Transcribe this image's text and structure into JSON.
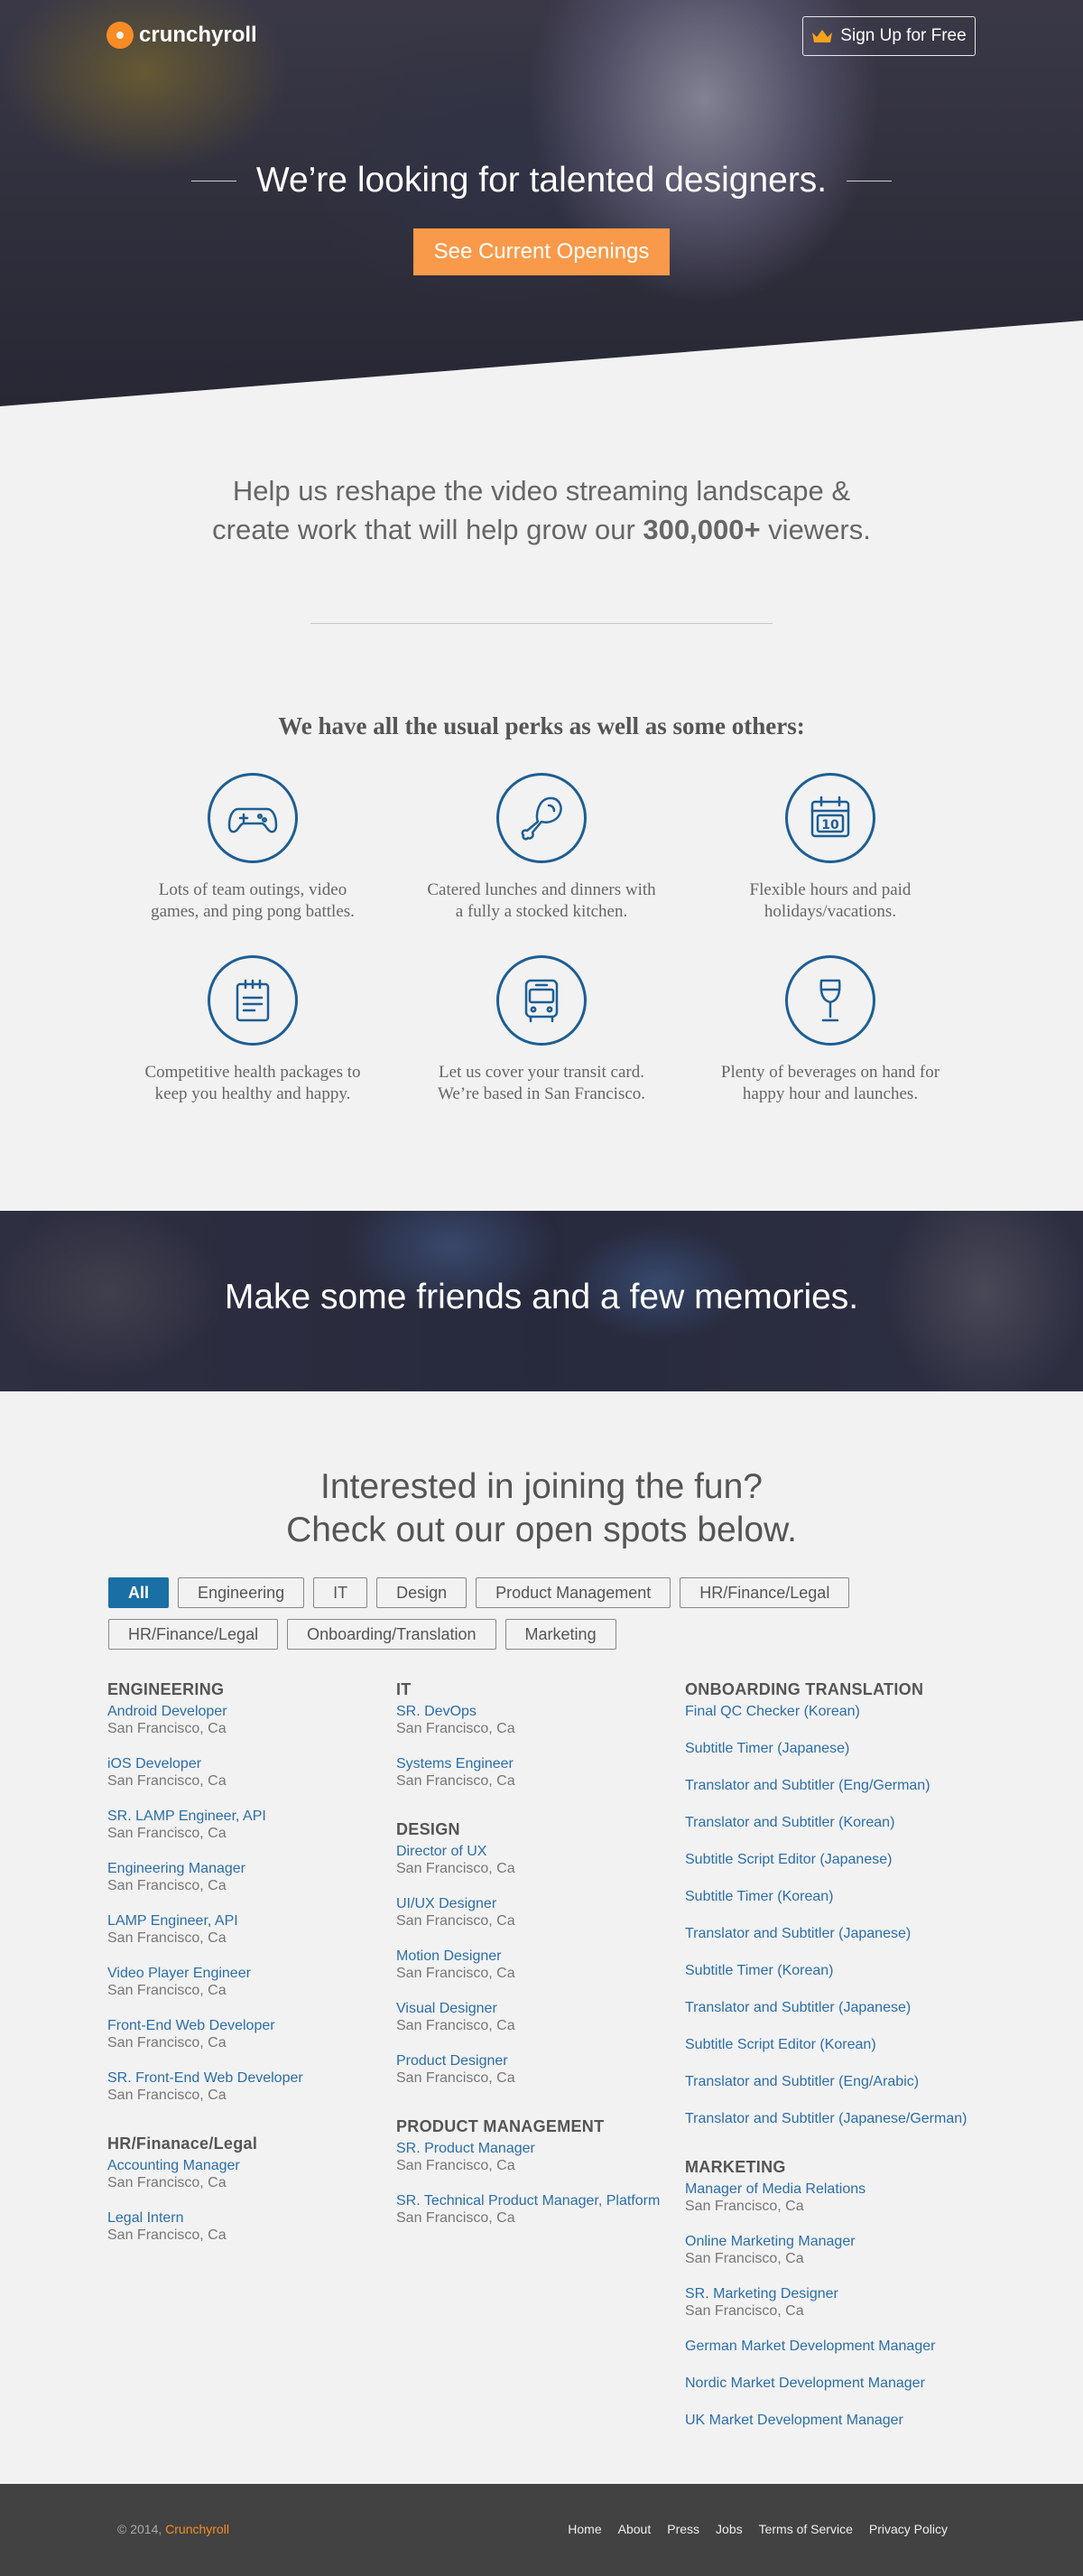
{
  "header": {
    "brand": "crunchyroll",
    "signup_label": "Sign Up for Free"
  },
  "hero": {
    "title": "We’re looking for talented designers.",
    "cta_label": "See Current Openings"
  },
  "intro": {
    "line1": "Help us reshape the video streaming landscape &",
    "line2_pre": "create work that will help grow our ",
    "line2_strong": "300,000+",
    "line2_post": " viewers."
  },
  "perks": {
    "title": "We have all the usual perks as well as some others:",
    "items": [
      {
        "icon": "gamepad-icon",
        "text": "Lots of team outings, video games, and ping pong battles."
      },
      {
        "icon": "drumstick-icon",
        "text": "Catered lunches and dinners with a fully a stocked kitchen."
      },
      {
        "icon": "calendar-icon",
        "text": "Flexible hours and paid holidays/vacations."
      },
      {
        "icon": "clipboard-icon",
        "text": "Competitive health packages to keep you healthy and happy."
      },
      {
        "icon": "bus-icon",
        "text": "Let us cover your transit card. We’re based in San Francisco."
      },
      {
        "icon": "wine-glass-icon",
        "text": "Plenty of beverages on hand for happy hour and launches."
      }
    ]
  },
  "banner": {
    "title": "Make some friends and a few memories."
  },
  "jobs": {
    "heading1": "Interested in joining the fun?",
    "heading2": "Check out our open spots below.",
    "filters": [
      "All",
      "Engineering",
      "IT",
      "Design",
      "Product Management",
      "HR/Finance/Legal",
      "HR/Finance/Legal",
      "Onboarding/Translation",
      "Marketing"
    ],
    "columns": [
      [
        {
          "title": "ENGINEERING",
          "jobs": [
            {
              "name": "Android Developer",
              "loc": "San Francisco, Ca"
            },
            {
              "name": "iOS Developer",
              "loc": "San Francisco, Ca"
            },
            {
              "name": "SR. LAMP Engineer, API",
              "loc": "San Francisco, Ca"
            },
            {
              "name": "Engineering Manager",
              "loc": "San Francisco, Ca"
            },
            {
              "name": "LAMP Engineer, API",
              "loc": "San Francisco, Ca"
            },
            {
              "name": "Video Player Engineer",
              "loc": "San Francisco, Ca"
            },
            {
              "name": "Front-End Web Developer",
              "loc": "San Francisco, Ca"
            },
            {
              "name": "SR. Front-End Web Developer",
              "loc": "San Francisco, Ca"
            }
          ]
        },
        {
          "title": "HR/Finanace/Legal",
          "jobs": [
            {
              "name": "Accounting Manager",
              "loc": "San Francisco, Ca"
            },
            {
              "name": "Legal Intern",
              "loc": "San Francisco, Ca"
            }
          ]
        }
      ],
      [
        {
          "title": "IT",
          "jobs": [
            {
              "name": "SR. DevOps",
              "loc": "San Francisco, Ca"
            },
            {
              "name": "Systems Engineer",
              "loc": "San Francisco, Ca"
            }
          ]
        },
        {
          "title": "DESIGN",
          "jobs": [
            {
              "name": "Director of UX",
              "loc": "San Francisco, Ca"
            },
            {
              "name": "UI/UX Designer",
              "loc": "San Francisco, Ca"
            },
            {
              "name": "Motion Designer",
              "loc": "San Francisco, Ca"
            },
            {
              "name": "Visual Designer",
              "loc": "San Francisco, Ca"
            },
            {
              "name": "Product Designer",
              "loc": "San Francisco, Ca"
            }
          ]
        },
        {
          "title": "PRODUCT MANAGEMENT",
          "jobs": [
            {
              "name": "SR. Product Manager",
              "loc": "San Francisco, Ca"
            },
            {
              "name": "SR. Technical Product Manager, Platform",
              "loc": "San Francisco, Ca"
            }
          ]
        }
      ],
      [
        {
          "title": "ONBOARDING TRANSLATION",
          "jobs": [
            {
              "name": "Final QC Checker (Korean)",
              "loc": ""
            },
            {
              "name": "Subtitle Timer (Japanese)",
              "loc": ""
            },
            {
              "name": "Translator and Subtitler (Eng/German)",
              "loc": ""
            },
            {
              "name": "Translator and Subtitler (Korean)",
              "loc": ""
            },
            {
              "name": "Subtitle Script Editor (Japanese)",
              "loc": ""
            },
            {
              "name": "Subtitle Timer (Korean)",
              "loc": ""
            },
            {
              "name": "Translator and Subtitler (Japanese)",
              "loc": ""
            },
            {
              "name": "Subtitle Timer (Korean)",
              "loc": ""
            },
            {
              "name": "Translator and Subtitler (Japanese)",
              "loc": ""
            },
            {
              "name": "Subtitle Script Editor (Korean)",
              "loc": ""
            },
            {
              "name": "Translator and Subtitler (Eng/Arabic)",
              "loc": ""
            },
            {
              "name": "Translator and Subtitler (Japanese/German)",
              "loc": ""
            }
          ]
        },
        {
          "title": "MARKETING",
          "jobs": [
            {
              "name": "Manager of Media Relations",
              "loc": "San Francisco, Ca"
            },
            {
              "name": "Online Marketing Manager",
              "loc": "San Francisco, Ca"
            },
            {
              "name": "SR. Marketing Designer",
              "loc": "San Francisco, Ca"
            },
            {
              "name": "German Market Development Manager",
              "loc": ""
            },
            {
              "name": "Nordic Market Development Manager",
              "loc": ""
            },
            {
              "name": "UK Market Development Manager",
              "loc": ""
            }
          ]
        }
      ]
    ]
  },
  "footer": {
    "copy": "© 2014, ",
    "brand": "Crunchyroll",
    "links": [
      "Home",
      "About",
      "Press",
      "Jobs",
      "Terms of Service",
      "Privacy Policy"
    ]
  },
  "colors": {
    "accent_orange": "#f78b24",
    "cta_orange": "#f89a4a",
    "link_blue": "#2c6ea8",
    "icon_blue": "#1d5e94",
    "filter_active": "#1a6fa4"
  }
}
